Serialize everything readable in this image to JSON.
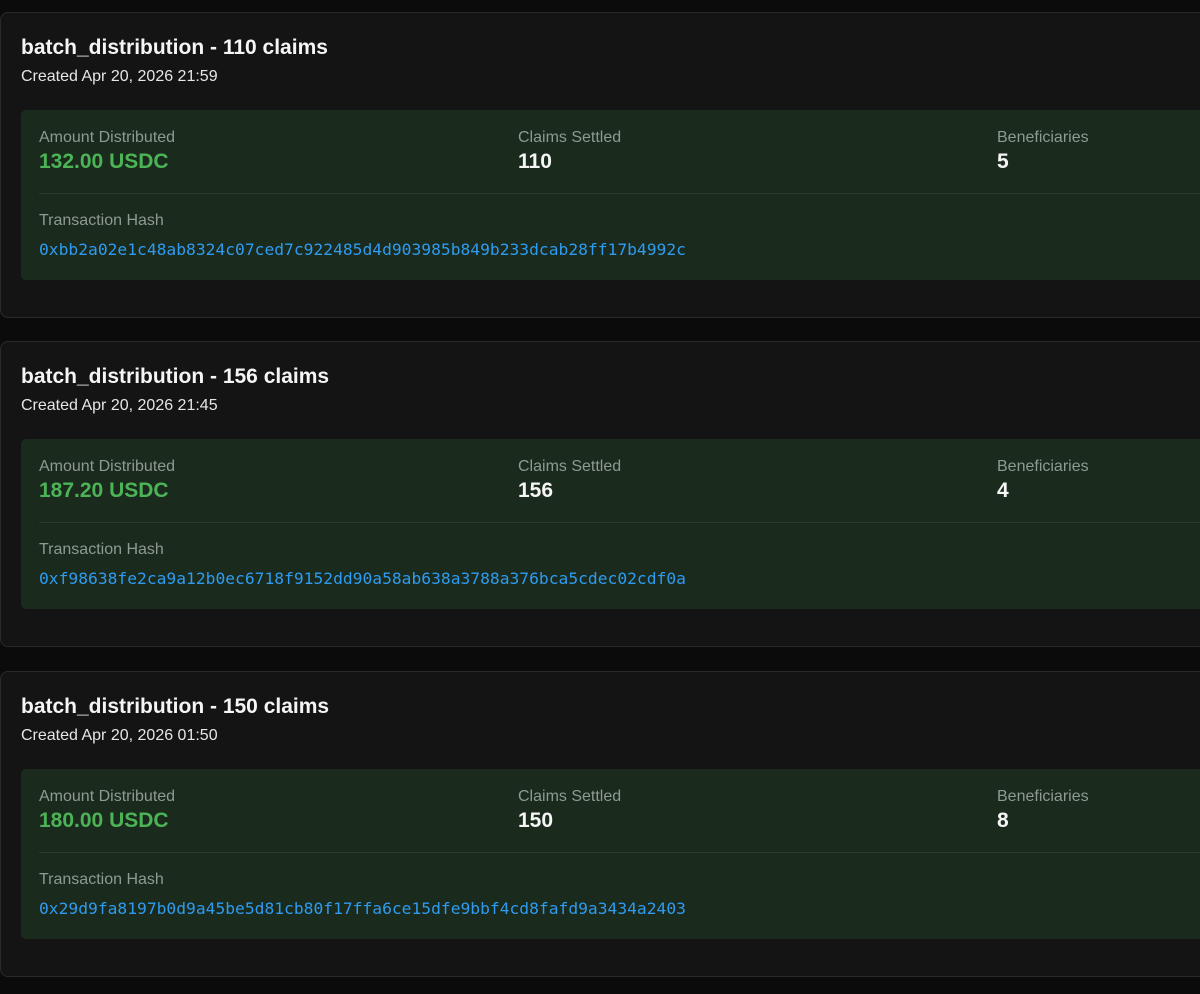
{
  "labels": {
    "amount": "Amount Distributed",
    "claims": "Claims Settled",
    "beneficiaries": "Beneficiaries",
    "hash": "Transaction Hash"
  },
  "colors": {
    "amount_green": "#4cb356",
    "hash_blue": "#2e9bf0",
    "panel_bg": "#1a2a1c",
    "card_bg": "#141414"
  },
  "distributions": [
    {
      "title": "batch_distribution - 110 claims",
      "created": "Created Apr 20, 2026 21:59",
      "amount": "132.00 USDC",
      "claims": "110",
      "beneficiaries": "5",
      "hash": "0xbb2a02e1c48ab8324c07ced7c922485d4d903985b849b233dcab28ff17b4992c"
    },
    {
      "title": "batch_distribution - 156 claims",
      "created": "Created Apr 20, 2026 21:45",
      "amount": "187.20 USDC",
      "claims": "156",
      "beneficiaries": "4",
      "hash": "0xf98638fe2ca9a12b0ec6718f9152dd90a58ab638a3788a376bca5cdec02cdf0a"
    },
    {
      "title": "batch_distribution - 150 claims",
      "created": "Created Apr 20, 2026 01:50",
      "amount": "180.00 USDC",
      "claims": "150",
      "beneficiaries": "8",
      "hash": "0x29d9fa8197b0d9a45be5d81cb80f17ffa6ce15dfe9bbf4cd8fafd9a3434a2403"
    }
  ]
}
